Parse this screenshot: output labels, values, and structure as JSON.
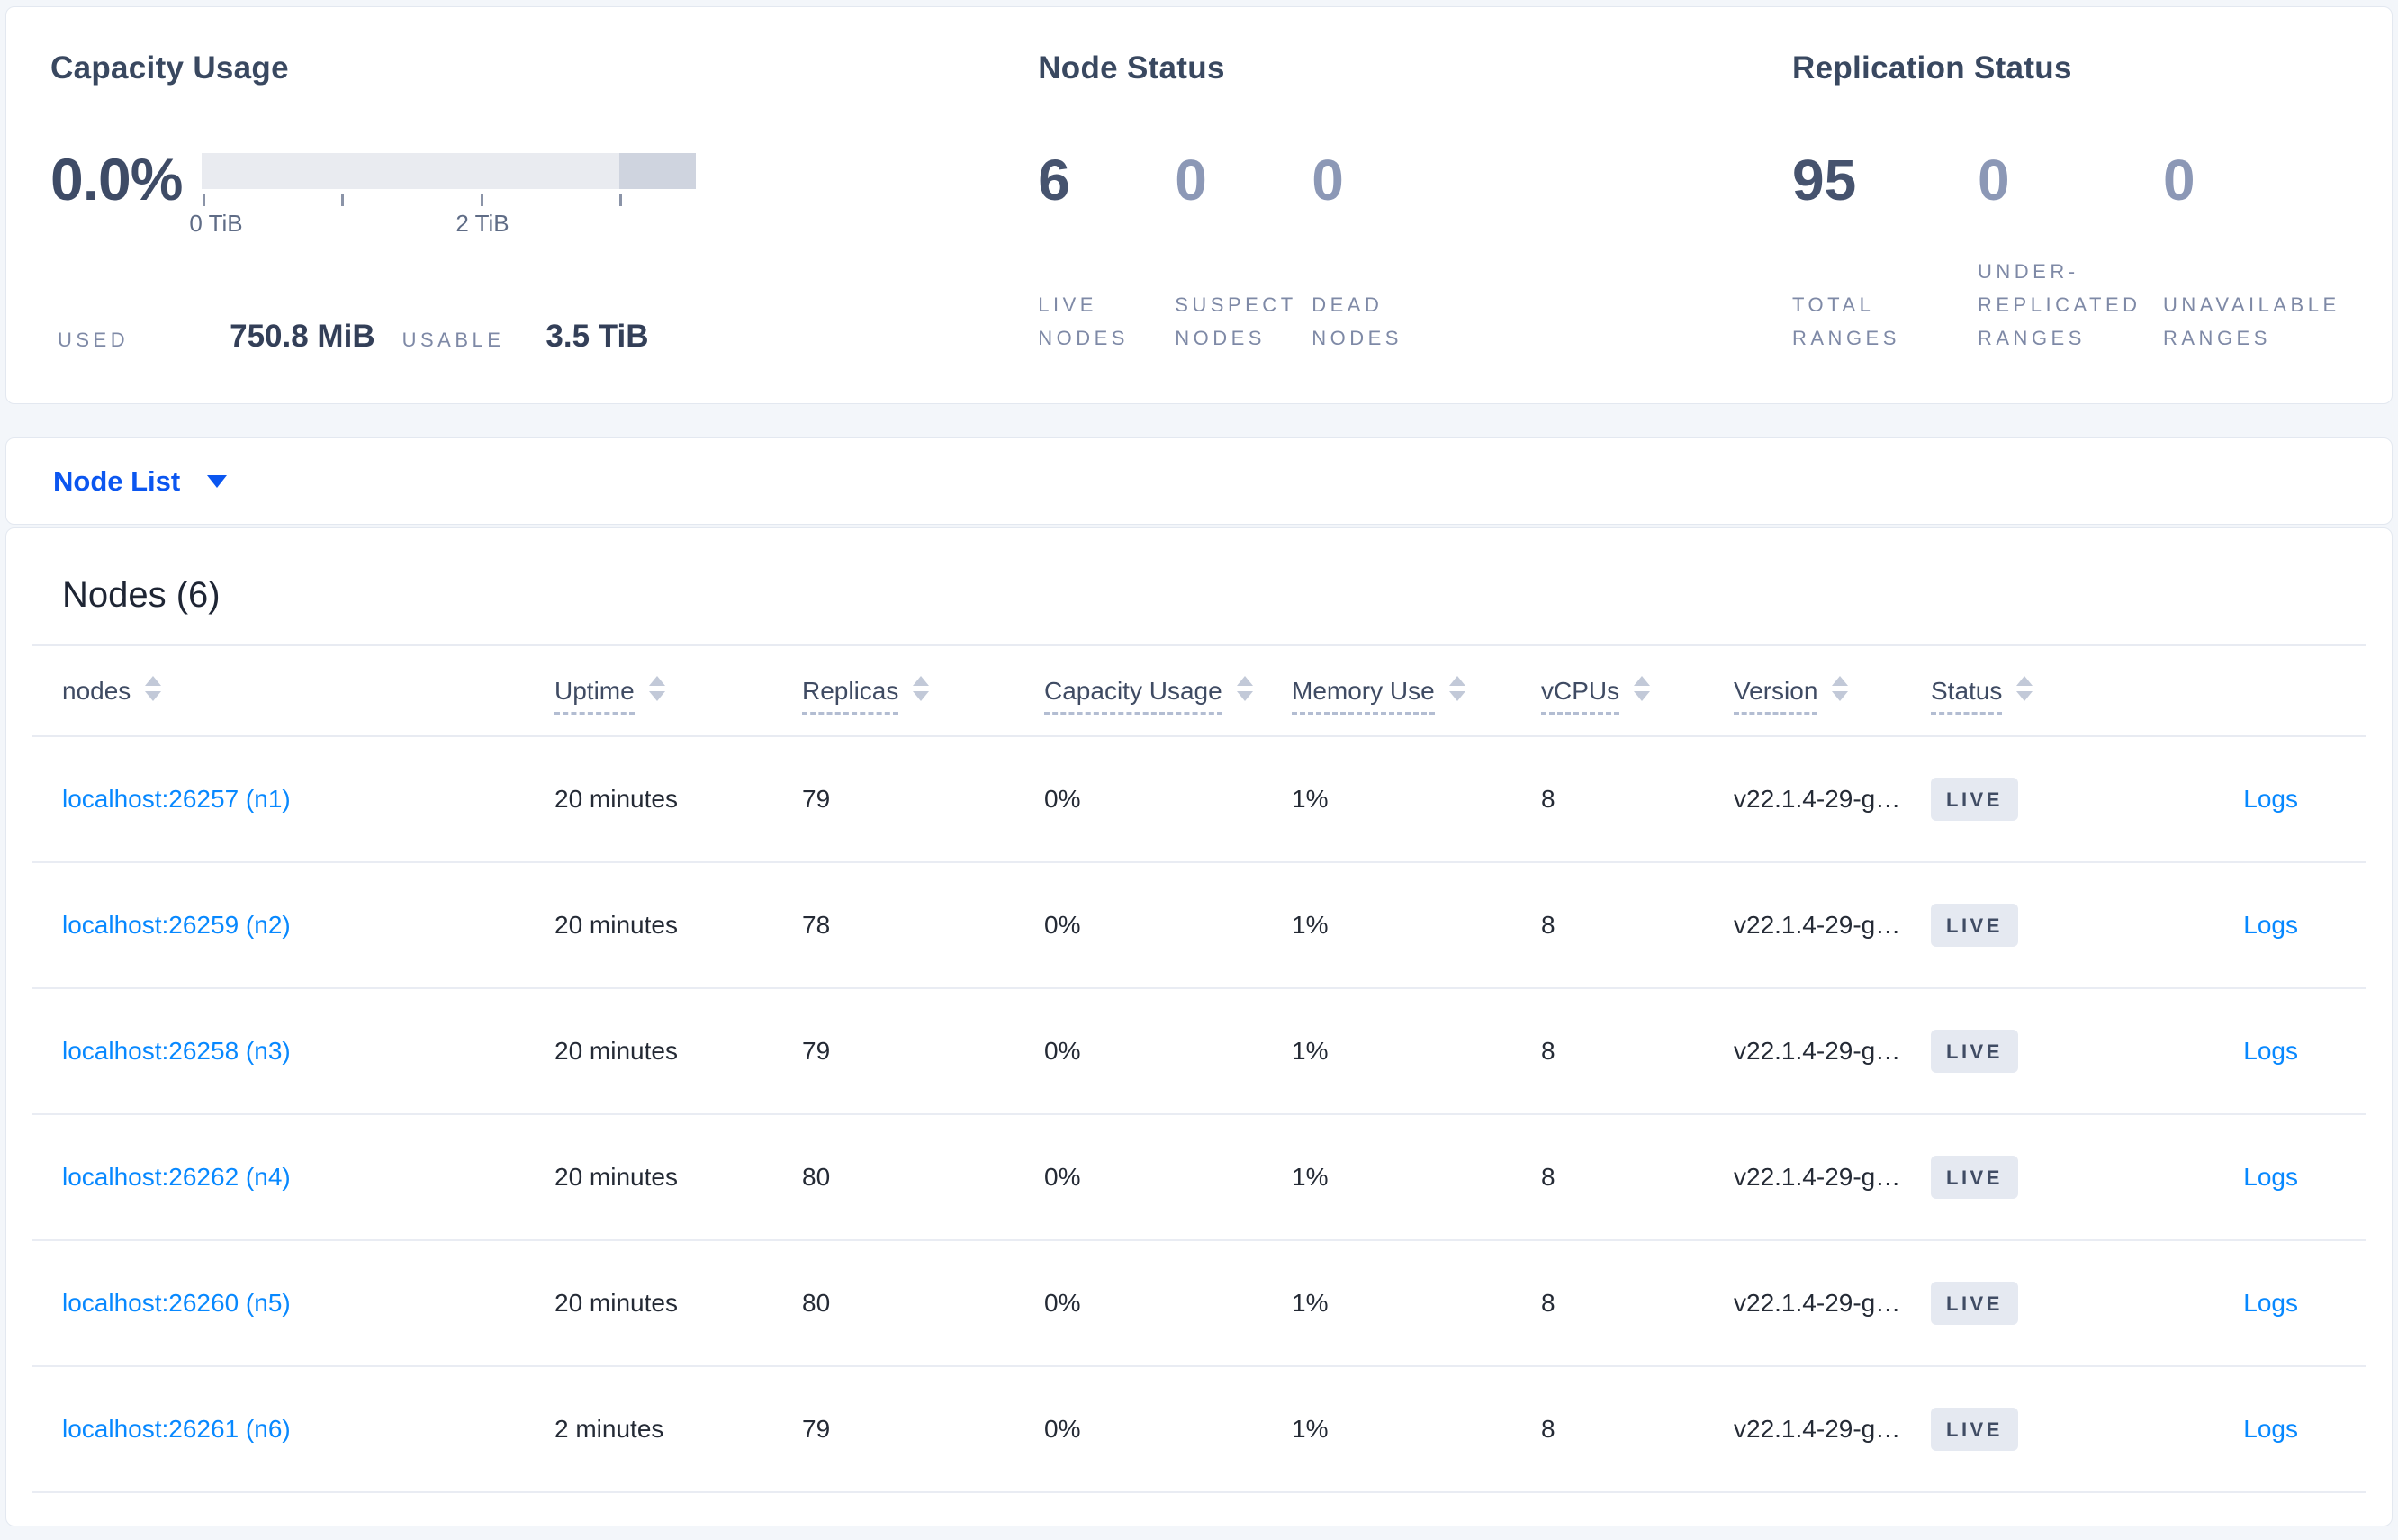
{
  "capacity_usage": {
    "title": "Capacity Usage",
    "percent": "0.0%",
    "axis_label_0": "0 TiB",
    "axis_label_2": "2 TiB",
    "used_label": "USED",
    "used_value": "750.8 MiB",
    "usable_label": "USABLE",
    "usable_value": "3.5 TiB"
  },
  "node_status": {
    "title": "Node Status",
    "stats": [
      {
        "value": "6",
        "label": "LIVE\nNODES"
      },
      {
        "value": "0",
        "label": "SUSPECT\nNODES"
      },
      {
        "value": "0",
        "label": "DEAD\nNODES"
      }
    ]
  },
  "replication_status": {
    "title": "Replication Status",
    "stats": [
      {
        "value": "95",
        "label": "TOTAL\nRANGES"
      },
      {
        "value": "0",
        "label": "UNDER-\nREPLICATED\nRANGES"
      },
      {
        "value": "0",
        "label": "UNAVAILABLE\nRANGES"
      }
    ]
  },
  "node_list": {
    "selector_label": "Node List",
    "heading": "Nodes (6)",
    "columns": [
      {
        "label": "nodes"
      },
      {
        "label": "Uptime"
      },
      {
        "label": "Replicas"
      },
      {
        "label": "Capacity Usage"
      },
      {
        "label": "Memory Use"
      },
      {
        "label": "vCPUs"
      },
      {
        "label": "Version"
      },
      {
        "label": "Status"
      }
    ],
    "rows": [
      {
        "node": "localhost:26257 (n1)",
        "uptime": "20 minutes",
        "replicas": "79",
        "capacity": "0%",
        "memory": "1%",
        "vcpus": "8",
        "version": "v22.1.4-29-g…",
        "status": "LIVE",
        "logs": "Logs"
      },
      {
        "node": "localhost:26259 (n2)",
        "uptime": "20 minutes",
        "replicas": "78",
        "capacity": "0%",
        "memory": "1%",
        "vcpus": "8",
        "version": "v22.1.4-29-g…",
        "status": "LIVE",
        "logs": "Logs"
      },
      {
        "node": "localhost:26258 (n3)",
        "uptime": "20 minutes",
        "replicas": "79",
        "capacity": "0%",
        "memory": "1%",
        "vcpus": "8",
        "version": "v22.1.4-29-g…",
        "status": "LIVE",
        "logs": "Logs"
      },
      {
        "node": "localhost:26262 (n4)",
        "uptime": "20 minutes",
        "replicas": "80",
        "capacity": "0%",
        "memory": "1%",
        "vcpus": "8",
        "version": "v22.1.4-29-g…",
        "status": "LIVE",
        "logs": "Logs"
      },
      {
        "node": "localhost:26260 (n5)",
        "uptime": "20 minutes",
        "replicas": "80",
        "capacity": "0%",
        "memory": "1%",
        "vcpus": "8",
        "version": "v22.1.4-29-g…",
        "status": "LIVE",
        "logs": "Logs"
      },
      {
        "node": "localhost:26261 (n6)",
        "uptime": "2 minutes",
        "replicas": "79",
        "capacity": "0%",
        "memory": "1%",
        "vcpus": "8",
        "version": "v22.1.4-29-g…",
        "status": "LIVE",
        "logs": "Logs"
      }
    ]
  },
  "colors": {
    "accent_blue": "#0b56f0",
    "link_blue": "#0788ff",
    "badge_bg": "#e5e9f1",
    "page_bg": "#f3f6fa"
  }
}
